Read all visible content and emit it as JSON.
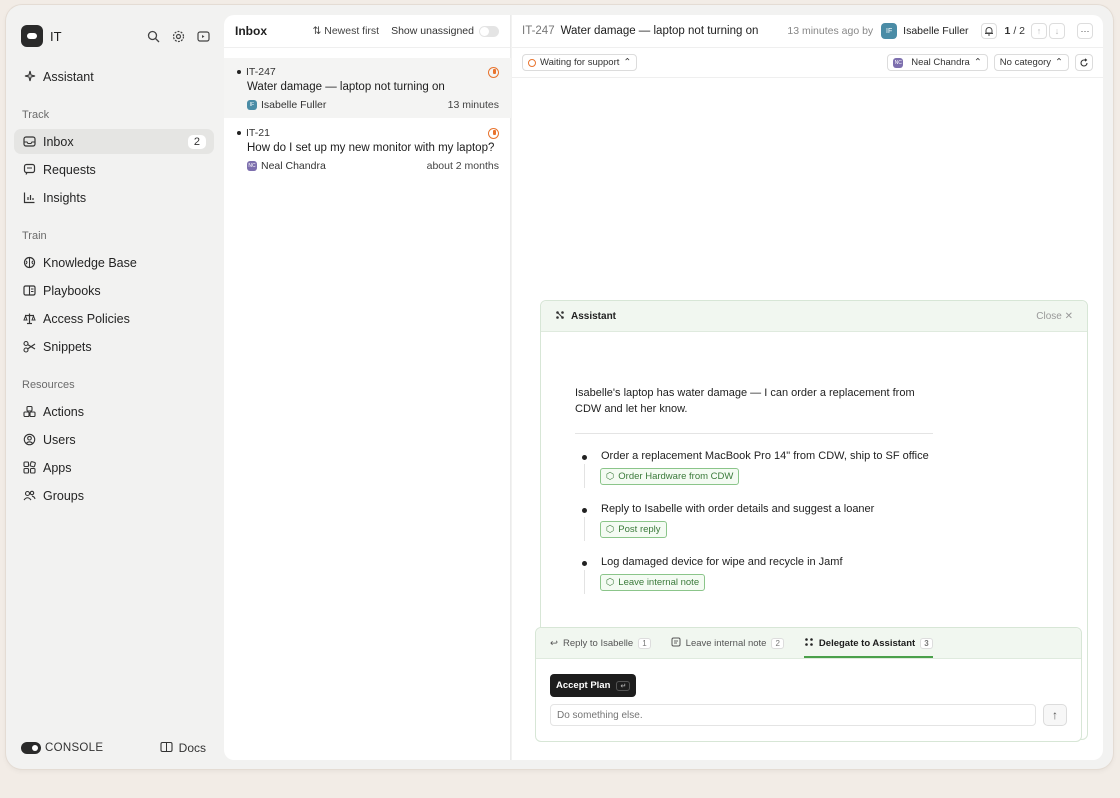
{
  "workspace": {
    "name": "IT"
  },
  "sidebar": {
    "assistant_label": "Assistant",
    "sections": {
      "track": "Track",
      "train": "Train",
      "resources": "Resources"
    },
    "items": {
      "inbox": {
        "label": "Inbox",
        "badge": "2"
      },
      "requests": {
        "label": "Requests"
      },
      "insights": {
        "label": "Insights"
      },
      "knowledge_base": {
        "label": "Knowledge Base"
      },
      "playbooks": {
        "label": "Playbooks"
      },
      "access_policies": {
        "label": "Access Policies"
      },
      "snippets": {
        "label": "Snippets"
      },
      "actions": {
        "label": "Actions"
      },
      "users": {
        "label": "Users"
      },
      "apps": {
        "label": "Apps"
      },
      "groups": {
        "label": "Groups"
      }
    },
    "footer": {
      "brand": "CONSOLE",
      "docs": "Docs"
    }
  },
  "inbox": {
    "title": "Inbox",
    "sort_label": "Newest first",
    "unassigned_label": "Show unassigned",
    "tickets": [
      {
        "id": "IT-247",
        "title": "Water damage — laptop not turning on",
        "requester": "Isabelle Fuller",
        "avatar": "IF",
        "avatar_color": "#4a8ca6",
        "time": "13 minutes"
      },
      {
        "id": "IT-21",
        "title": "How do I set up my new monitor with my laptop?",
        "requester": "Neal Chandra",
        "avatar": "NC",
        "avatar_color": "#7d6fae",
        "time": "about 2 months"
      }
    ]
  },
  "detail": {
    "id": "IT-247",
    "title": "Water damage — laptop not turning on",
    "ago": "13 minutes ago by",
    "author": "Isabelle Fuller",
    "author_initials": "IF",
    "pager_current": "1",
    "pager_total": "/ 2",
    "status": "Waiting for support",
    "assignee": "Neal Chandra",
    "assignee_initials": "NC",
    "category": "No category"
  },
  "assistant": {
    "title": "Assistant",
    "close_label": "Close",
    "message": "Isabelle's laptop has water damage — I can order a replacement from CDW and let her know.",
    "steps": [
      {
        "text": "Order a replacement MacBook Pro 14\" from CDW, ship to SF office",
        "action": "Order Hardware from CDW"
      },
      {
        "text": "Reply to Isabelle with order details and suggest a loaner",
        "action": "Post reply"
      },
      {
        "text": "Log damaged device for wipe and recycle in Jamf",
        "action": "Leave internal note"
      }
    ]
  },
  "composer": {
    "tabs": [
      {
        "label": "Reply to Isabelle",
        "key": "1"
      },
      {
        "label": "Leave internal note",
        "key": "2"
      },
      {
        "label": "Delegate to Assistant",
        "key": "3"
      }
    ],
    "accept_label": "Accept Plan",
    "accept_key": "↵",
    "input_placeholder": "Do something else."
  }
}
